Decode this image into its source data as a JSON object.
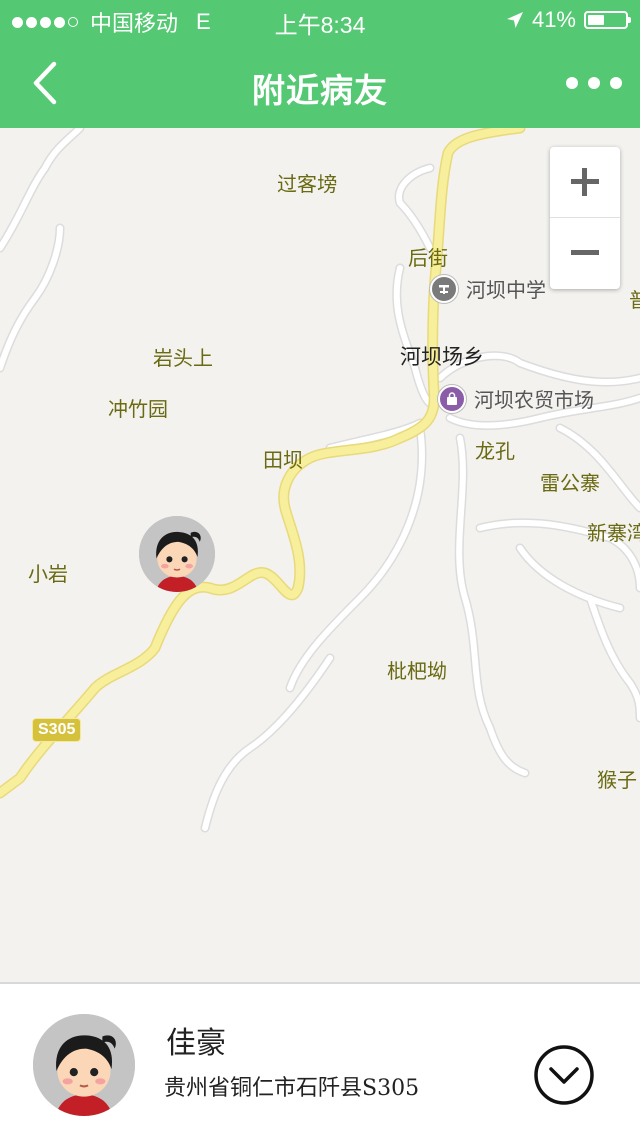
{
  "status_bar": {
    "carrier": "中国移动",
    "network": "E",
    "time": "上午8:34",
    "battery": "41%",
    "signal_bars": 4,
    "battery_level": 0.41
  },
  "navbar": {
    "title": "附近病友",
    "back_icon": "chevron-left-icon",
    "more_icon": "more-dots-icon"
  },
  "map": {
    "labels": [
      {
        "text": "过客塝",
        "kind": "village"
      },
      {
        "text": "后街",
        "kind": "village"
      },
      {
        "text": "岩头上",
        "kind": "village"
      },
      {
        "text": "冲竹园",
        "kind": "village"
      },
      {
        "text": "河坝场乡",
        "kind": "town"
      },
      {
        "text": "田坝",
        "kind": "village"
      },
      {
        "text": "龙孔",
        "kind": "village"
      },
      {
        "text": "雷公寨",
        "kind": "village"
      },
      {
        "text": "新寨湾",
        "kind": "village"
      },
      {
        "text": "小岩",
        "kind": "village"
      },
      {
        "text": "枇杷坳",
        "kind": "village"
      },
      {
        "text": "猴子",
        "kind": "village"
      },
      {
        "text": "普",
        "kind": "village"
      }
    ],
    "pois": [
      {
        "text": "河坝中学",
        "icon": "school-icon"
      },
      {
        "text": "河坝农贸市场",
        "icon": "shopping-bag-icon"
      }
    ],
    "road_shield": "S305",
    "zoom_in_icon": "plus-icon",
    "zoom_out_icon": "minus-icon",
    "colors": {
      "background": "#f3f2ef",
      "major_road": "#f8ef9c",
      "minor_road": "#ffffff",
      "label": "#6a6a12"
    }
  },
  "user_card": {
    "name": "佳豪",
    "address": "贵州省铜仁市石阡县S305",
    "expand_icon": "chevron-down-circle-icon"
  },
  "colors": {
    "accent": "#55c873"
  }
}
